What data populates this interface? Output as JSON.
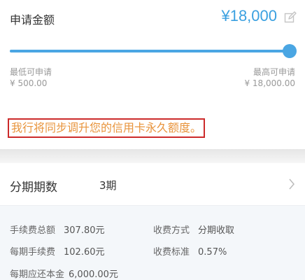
{
  "application": {
    "label": "申请金额",
    "amount": "¥18,000"
  },
  "slider": {
    "min_label": "最低可申请",
    "min_value": "¥ 500.00",
    "max_label": "最高可申请",
    "max_value": "¥ 18,000.00",
    "level": 1.0
  },
  "notice": "我行将同步调升您的信用卡永久额度。",
  "period": {
    "label": "分期期数",
    "value": "3期"
  },
  "fees": {
    "total_fee_label": "手续费总额",
    "total_fee_value": "307.80元",
    "method_label": "收费方式",
    "method_value": "分期收取",
    "per_period_fee_label": "每期手续费",
    "per_period_fee_value": "102.60元",
    "rate_label": "收费标准",
    "rate_value": "0.57%",
    "principal_label": "每期应还本金",
    "principal_value": "6,000.00元"
  },
  "colors": {
    "accent": "#3aa0e0",
    "notice_text": "#e8943c",
    "notice_border": "#cc2a2a"
  },
  "icons": {
    "edit": "edit-icon",
    "chevron": "chevron-right-icon"
  }
}
